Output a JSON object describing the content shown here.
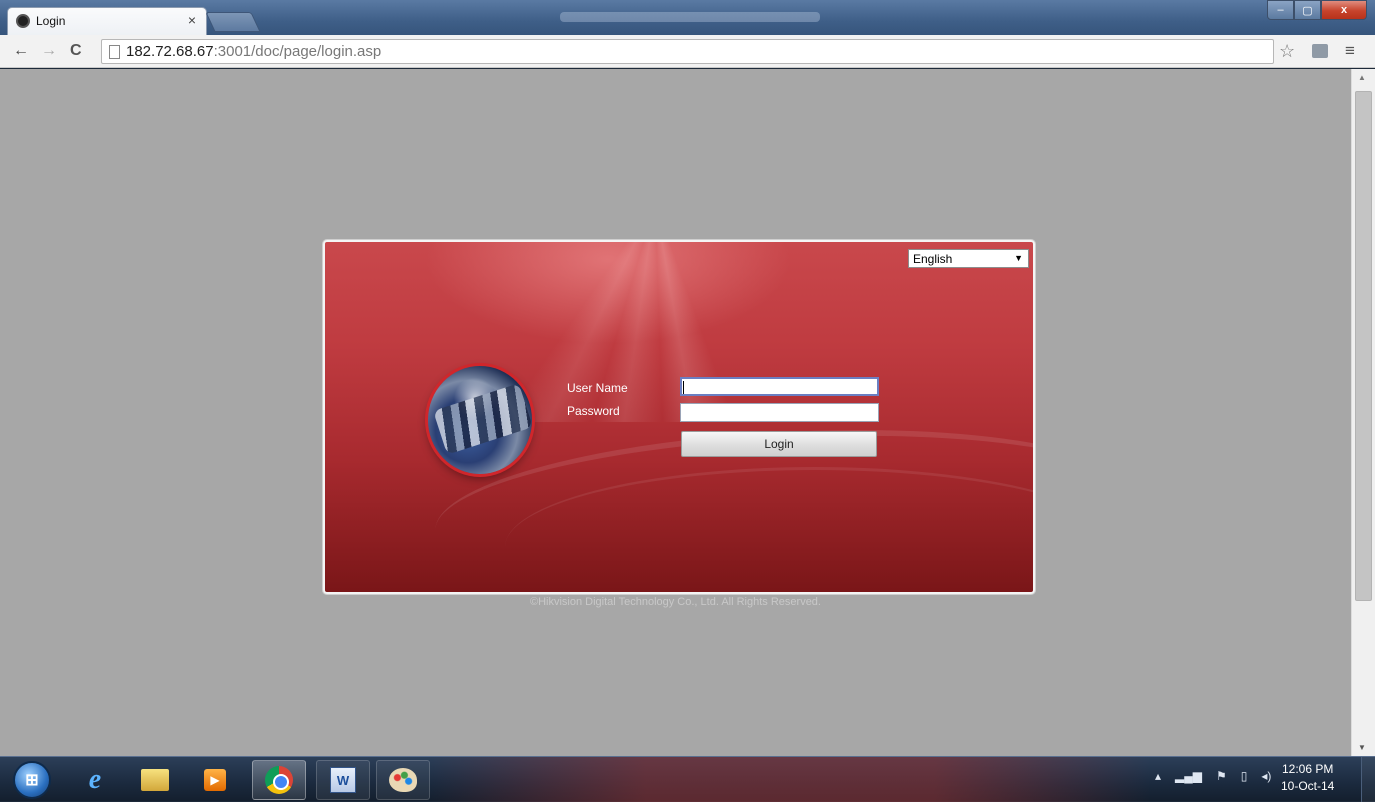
{
  "browser": {
    "tab_title": "Login",
    "tab_close": "×",
    "window_buttons": {
      "minimize": "–",
      "maximize": "▢",
      "close": "x"
    },
    "nav": {
      "back": "←",
      "forward": "→",
      "reload": "C"
    },
    "url_host": "182.72.68.67",
    "url_path": ":3001/doc/page/login.asp",
    "star": "☆",
    "menu": "≡"
  },
  "login": {
    "language_selected": "English",
    "language_arrow": "▼",
    "username_label": "User Name",
    "password_label": "Password",
    "username_value": "",
    "password_value": "",
    "login_button": "Login",
    "copyright": "©Hikvision Digital Technology Co., Ltd. All Rights Reserved."
  },
  "scrollbar": {
    "up": "▲",
    "down": "▼"
  },
  "taskbar": {
    "start": "⊞",
    "ie_label": "e",
    "media_label": "▶",
    "word_label": "W",
    "tray_icons": [
      "▴",
      "▂▄▆",
      "⚑",
      "▯",
      "◂)"
    ],
    "time": "12:06 PM",
    "date": "10-Oct-14"
  },
  "colors": {
    "panel_red": "#bf3b40",
    "page_gray": "#a7a7a7",
    "accent_blue": "#6b7fc2"
  }
}
